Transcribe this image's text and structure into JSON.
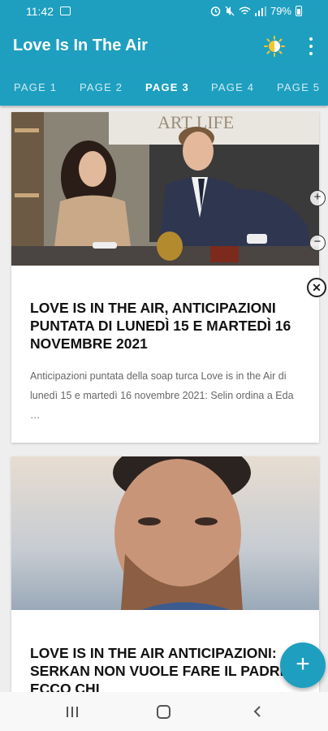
{
  "status": {
    "time": "11:42",
    "battery": "79%",
    "icons": [
      "image-icon",
      "alarm-icon",
      "mute-icon",
      "wifi-icon",
      "signal-icon",
      "battery-icon"
    ]
  },
  "app": {
    "title": "Love Is In The Air",
    "theme_icon": "day-night-icon",
    "menu_icon": "more-vert-icon",
    "accent_color": "#1e9fc0"
  },
  "tabs": [
    {
      "label": "PAGE 1",
      "active": false
    },
    {
      "label": "PAGE 2",
      "active": false
    },
    {
      "label": "PAGE 3",
      "active": true
    },
    {
      "label": "PAGE 4",
      "active": false
    },
    {
      "label": "PAGE 5",
      "active": false
    }
  ],
  "articles": [
    {
      "image": "two people at an office desk",
      "title": "Love Is In The Air, anticipazioni puntata di lunedì 15 e martedì 16 novembre 2021",
      "excerpt": "Anticipazioni puntata della soap turca Love is in the Air di lunedì 15 e martedì 16 novembre 2021: Selin ordina a Eda …",
      "image_text": "ART LIFE"
    },
    {
      "image": "man by the sea",
      "title": "Love Is In The Air anticipazioni: Serkan non vuole fare il padre? Ecco chi"
    }
  ],
  "ad_controls": {
    "close_symbol": "✕",
    "expand_symbol": "+",
    "collapse_symbol": "−"
  },
  "fab": {
    "symbol": "+",
    "icon": "add-icon"
  },
  "nav": {
    "icons": [
      "recent-apps-icon",
      "home-icon",
      "back-icon"
    ]
  }
}
